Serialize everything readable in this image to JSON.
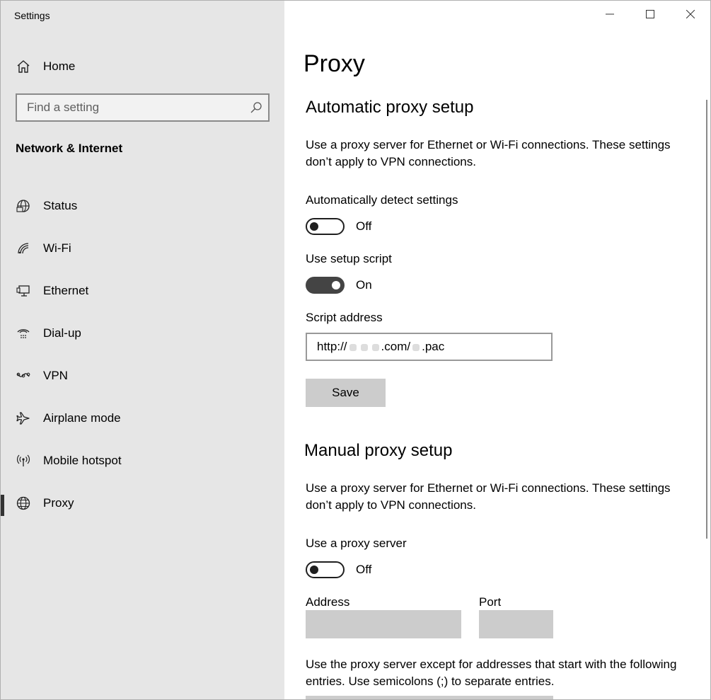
{
  "app": {
    "title": "Settings"
  },
  "sidebar": {
    "home_label": "Home",
    "search_placeholder": "Find a setting",
    "section_title": "Network & Internet",
    "items": [
      {
        "label": "Status",
        "icon": "globe-status-icon"
      },
      {
        "label": "Wi-Fi",
        "icon": "wifi-icon"
      },
      {
        "label": "Ethernet",
        "icon": "ethernet-icon"
      },
      {
        "label": "Dial-up",
        "icon": "dialup-icon"
      },
      {
        "label": "VPN",
        "icon": "vpn-icon"
      },
      {
        "label": "Airplane mode",
        "icon": "airplane-icon"
      },
      {
        "label": "Mobile hotspot",
        "icon": "hotspot-icon"
      },
      {
        "label": "Proxy",
        "icon": "globe-icon",
        "active": true
      }
    ]
  },
  "main": {
    "page_title": "Proxy",
    "auto": {
      "heading": "Automatic proxy setup",
      "description": "Use a proxy server for Ethernet or Wi-Fi connections. These settings don’t apply to VPN connections.",
      "detect_label": "Automatically detect settings",
      "detect_state": "Off",
      "script_label": "Use setup script",
      "script_state": "On",
      "address_label": "Script address",
      "address_prefix": "http://",
      "address_mid": ".com/",
      "address_suffix": ".pac",
      "save_label": "Save"
    },
    "manual": {
      "heading": "Manual proxy setup",
      "description": "Use a proxy server for Ethernet or Wi-Fi connections. These settings don’t apply to VPN connections.",
      "use_proxy_label": "Use a proxy server",
      "use_proxy_state": "Off",
      "address_label": "Address",
      "port_label": "Port",
      "exceptions_text": "Use the proxy server except for addresses that start with the following entries. Use semicolons (;) to separate entries."
    }
  }
}
